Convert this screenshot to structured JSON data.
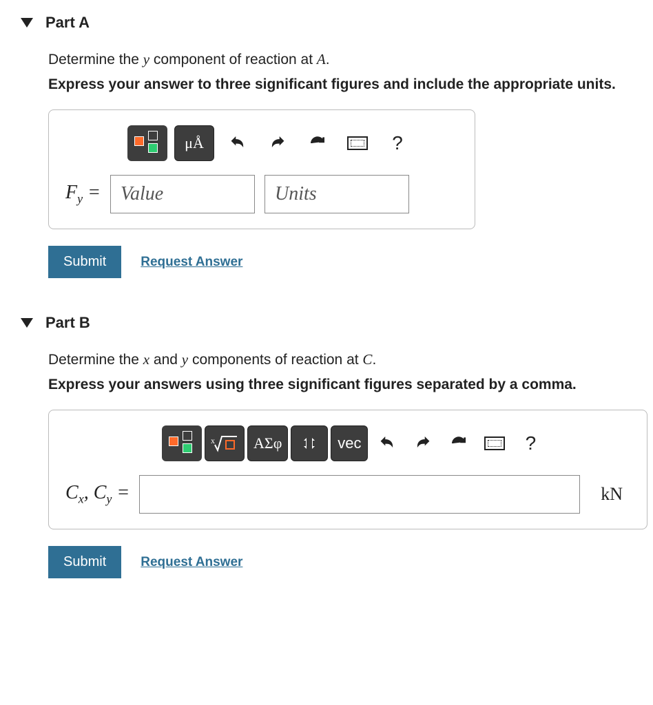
{
  "partA": {
    "title": "Part A",
    "question_pre": "Determine the ",
    "question_var": "y",
    "question_mid": " component of reaction at ",
    "question_point": "A",
    "question_post": ".",
    "instruction": "Express your answer to three significant figures and include the appropriate units.",
    "toolbar": {
      "units_btn": "μÅ",
      "help": "?"
    },
    "label_html": "F",
    "label_sub": "y",
    "equals": " = ",
    "value_placeholder": "Value",
    "units_placeholder": "Units",
    "submit": "Submit",
    "request": "Request Answer"
  },
  "partB": {
    "title": "Part B",
    "question_pre": "Determine the ",
    "question_var1": "x",
    "question_and": " and ",
    "question_var2": "y",
    "question_mid": " components of reaction at ",
    "question_point": "C",
    "question_post": ".",
    "instruction": "Express your answers using three significant figures separated by a comma.",
    "toolbar": {
      "greek_btn": "ΑΣφ",
      "vec_btn": "vec",
      "help": "?"
    },
    "label_c1": "C",
    "label_sub1": "x",
    "label_sep": ", ",
    "label_c2": "C",
    "label_sub2": "y",
    "equals": " = ",
    "unit_suffix": "kN",
    "submit": "Submit",
    "request": "Request Answer"
  }
}
